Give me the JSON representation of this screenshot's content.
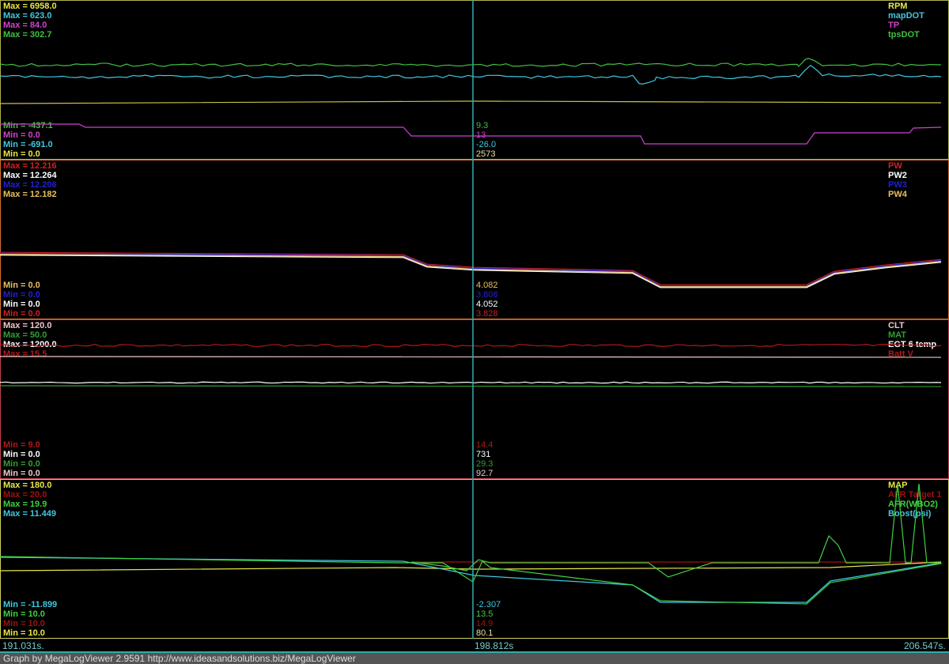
{
  "panels": [
    {
      "border": "#b0b050",
      "max": [
        {
          "t": "Max = 6958.0",
          "c": "#e8e84a"
        },
        {
          "t": "Max = 623.0",
          "c": "#40c8e0"
        },
        {
          "t": "Max = 84.0",
          "c": "#d040d0"
        },
        {
          "t": "Max = 302.7",
          "c": "#40c040"
        }
      ],
      "min": [
        {
          "t": "Min = -437.1",
          "c": "#40c040"
        },
        {
          "t": "Min = 0.0",
          "c": "#d040d0"
        },
        {
          "t": "Min = -691.0",
          "c": "#40c8e0"
        },
        {
          "t": "Min = 0.0",
          "c": "#e8e84a"
        }
      ],
      "cursor": [
        {
          "t": "9.3",
          "c": "#40c040"
        },
        {
          "t": "13",
          "c": "#d040d0"
        },
        {
          "t": "-26.0",
          "c": "#40c8e0"
        },
        {
          "t": "2573",
          "c": "#e8e0a0"
        }
      ],
      "names": [
        {
          "t": "RPM",
          "c": "#e8e84a"
        },
        {
          "t": "mapDOT",
          "c": "#40c8e0"
        },
        {
          "t": "TP",
          "c": "#d040d0"
        },
        {
          "t": "tpsDOT",
          "c": "#40c040"
        }
      ]
    },
    {
      "border": "#d07030",
      "max": [
        {
          "t": "Max = 12.216",
          "c": "#d02020"
        },
        {
          "t": "Max = 12.264",
          "c": "#ffffff"
        },
        {
          "t": "Max = 12.206",
          "c": "#2020d0"
        },
        {
          "t": "Max = 12.182",
          "c": "#e8c060"
        }
      ],
      "min": [
        {
          "t": "Min = 0.0",
          "c": "#e8c060"
        },
        {
          "t": "Min = 0.0",
          "c": "#2020d0"
        },
        {
          "t": "Min = 0.0",
          "c": "#ffffff"
        },
        {
          "t": "Min = 0.0",
          "c": "#d02020"
        }
      ],
      "cursor": [
        {
          "t": "4.082",
          "c": "#e8c060"
        },
        {
          "t": "3.808",
          "c": "#2020d0"
        },
        {
          "t": "4.052",
          "c": "#ffffff"
        },
        {
          "t": "3.828",
          "c": "#d02020"
        }
      ],
      "names": [
        {
          "t": "PW",
          "c": "#d02020"
        },
        {
          "t": "PW2",
          "c": "#ffffff"
        },
        {
          "t": "PW3",
          "c": "#2020d0"
        },
        {
          "t": "PW4",
          "c": "#e8c060"
        }
      ]
    },
    {
      "border": "#c04050",
      "max": [
        {
          "t": "Max = 120.0",
          "c": "#f0c8c8"
        },
        {
          "t": "Max = 50.0",
          "c": "#30a030"
        },
        {
          "t": "Max = 1200.0",
          "c": "#ffffff"
        },
        {
          "t": "Max = 15.5",
          "c": "#b01818"
        }
      ],
      "min": [
        {
          "t": "Min = 9.0",
          "c": "#b01818"
        },
        {
          "t": "Min = 0.0",
          "c": "#ffffff"
        },
        {
          "t": "Min = 0.0",
          "c": "#30a030"
        },
        {
          "t": "Min = 0.0",
          "c": "#f0c8c8"
        }
      ],
      "cursor": [
        {
          "t": "14.4",
          "c": "#b01818"
        },
        {
          "t": "731",
          "c": "#ffffff"
        },
        {
          "t": "29.3",
          "c": "#30a030"
        },
        {
          "t": "92.7",
          "c": "#f0c8c8"
        }
      ],
      "names": [
        {
          "t": "CLT",
          "c": "#f0c8c8"
        },
        {
          "t": "MAT",
          "c": "#30a030"
        },
        {
          "t": "EGT 6 temp",
          "c": "#ffffff"
        },
        {
          "t": "Batt V",
          "c": "#b01818"
        }
      ]
    },
    {
      "border": "#d0d060",
      "max": [
        {
          "t": "Max = 180.0",
          "c": "#e8e84a"
        },
        {
          "t": "Max = 20.0",
          "c": "#a01010"
        },
        {
          "t": "Max = 19.9",
          "c": "#40d040"
        },
        {
          "t": "Max = 11.449",
          "c": "#40c8e0"
        }
      ],
      "min": [
        {
          "t": "Min = -11.899",
          "c": "#40c8e0"
        },
        {
          "t": "Min = 10.0",
          "c": "#40d040"
        },
        {
          "t": "Min = 10.0",
          "c": "#a01010"
        },
        {
          "t": "Min = 10.0",
          "c": "#e8e84a"
        }
      ],
      "cursor": [
        {
          "t": "-2.307",
          "c": "#40c8e0"
        },
        {
          "t": "13.5",
          "c": "#40d040"
        },
        {
          "t": "14.9",
          "c": "#a01010"
        },
        {
          "t": "80.1",
          "c": "#e8e0a0"
        }
      ],
      "names": [
        {
          "t": "MAP",
          "c": "#e8e84a"
        },
        {
          "t": "AFR Target 1",
          "c": "#a01010"
        },
        {
          "t": "AFR(WBO2)",
          "c": "#40d040"
        },
        {
          "t": "Boost(psi)",
          "c": "#40c8e0"
        }
      ]
    }
  ],
  "timeline": {
    "start": "191.031s.",
    "cursor": "198.812s",
    "end": "206.547s."
  },
  "footer": "Graph by MegaLogViewer 2.9591 http://www.ideasandsolutions.biz/MegaLogViewer",
  "cursor_color": "#30b0b0"
}
